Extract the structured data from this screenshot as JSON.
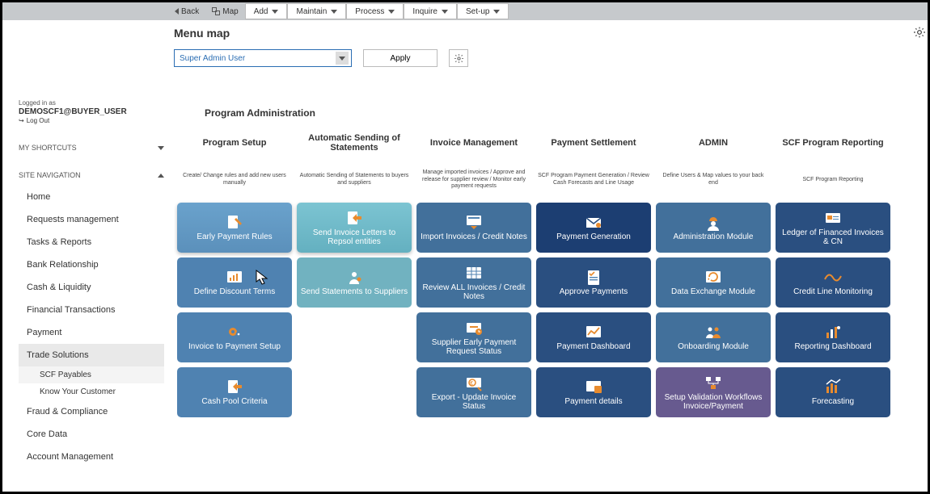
{
  "topbar": {
    "back": "Back",
    "map": "Map",
    "menus": [
      "Add",
      "Maintain",
      "Process",
      "Inquire",
      "Set-up"
    ]
  },
  "page_title": "Menu map",
  "filter": {
    "role": "Super Admin User",
    "apply": "Apply"
  },
  "login": {
    "prefix": "Logged in as",
    "user": "DEMOSCF1@BUYER_USER",
    "logout": "Log Out"
  },
  "nav_sections": {
    "shortcuts": "MY SHORTCUTS",
    "sitenav": "SITE NAVIGATION"
  },
  "nav": [
    {
      "label": "Home"
    },
    {
      "label": "Requests management"
    },
    {
      "label": "Tasks & Reports"
    },
    {
      "label": "Bank Relationship"
    },
    {
      "label": "Cash & Liquidity"
    },
    {
      "label": "Financial Transactions"
    },
    {
      "label": "Payment"
    },
    {
      "label": "Trade Solutions",
      "active": true,
      "subs": [
        {
          "label": "SCF Payables",
          "active": true
        },
        {
          "label": "Know Your Customer"
        }
      ]
    },
    {
      "label": "Fraud & Compliance"
    },
    {
      "label": "Core Data"
    },
    {
      "label": "Account Management"
    }
  ],
  "section_title": "Program Administration",
  "columns": [
    {
      "title": "Program Setup",
      "desc": "Create/ Change rules and add new users manually"
    },
    {
      "title": "Automatic Sending of Statements",
      "desc": "Automatic Sending of Statements to buyers and suppliers"
    },
    {
      "title": "Invoice Management",
      "desc": "Manage imported invoices / Approve and release for supplier review / Monitor early payment requests"
    },
    {
      "title": "Payment Settlement",
      "desc": "SCF Program Payment Generation / Review Cash Forecasts and Line Usage"
    },
    {
      "title": "ADMIN",
      "desc": "Define Users & Map values to your back end"
    },
    {
      "title": "SCF Program Reporting",
      "desc": "SCF Program Reporting"
    }
  ],
  "row1": [
    {
      "l": "Early Payment Rules",
      "c": "c-blue-hl",
      "i": "doc-pen"
    },
    {
      "l": "Send Invoice Letters to Repsol entities",
      "c": "c-teal-hl",
      "i": "doc-arrow"
    },
    {
      "l": "Import Invoices / Credit Notes",
      "c": "c-blue-m",
      "i": "upload"
    },
    {
      "l": "Payment Generation",
      "c": "c-navy",
      "i": "envelope"
    },
    {
      "l": "Administration Module",
      "c": "c-blue-m",
      "i": "worker"
    },
    {
      "l": "Ledger of Financed Invoices & CN",
      "c": "c-blue-d",
      "i": "card"
    }
  ],
  "row2": [
    {
      "l": "Define Discount Terms",
      "c": "c-blue-s",
      "i": "chart"
    },
    {
      "l": "Send Statements to Suppliers",
      "c": "c-teal",
      "i": "person"
    },
    {
      "l": "Review ALL Invoices / Credit Notes",
      "c": "c-blue-m",
      "i": "grid"
    },
    {
      "l": "Approve Payments",
      "c": "c-blue-d",
      "i": "checklist"
    },
    {
      "l": "Data Exchange Module",
      "c": "c-blue-m",
      "i": "cycle"
    },
    {
      "l": "Credit Line Monitoring",
      "c": "c-blue-d",
      "i": "wave"
    }
  ],
  "row3": [
    {
      "l": "Invoice to Payment Setup",
      "c": "c-blue-s",
      "i": "gear"
    },
    null,
    {
      "l": "Supplier Early Payment Request Status",
      "c": "c-blue-m",
      "i": "clock"
    },
    {
      "l": "Payment Dashboard",
      "c": "c-blue-d",
      "i": "trend"
    },
    {
      "l": "Onboarding Module",
      "c": "c-blue-m",
      "i": "people"
    },
    {
      "l": "Reporting Dashboard",
      "c": "c-blue-d",
      "i": "bars"
    }
  ],
  "row4": [
    {
      "l": "Cash Pool Criteria",
      "c": "c-blue-s",
      "i": "doc-arrow"
    },
    null,
    {
      "l": "Export - Update Invoice Status",
      "c": "c-blue-m",
      "i": "euro"
    },
    {
      "l": "Payment details",
      "c": "c-blue-d",
      "i": "screen"
    },
    {
      "l": "Setup Validation Workflows Invoice/Payment",
      "c": "c-purp",
      "i": "flow"
    },
    {
      "l": "Forecasting",
      "c": "c-blue-d",
      "i": "fore"
    }
  ]
}
